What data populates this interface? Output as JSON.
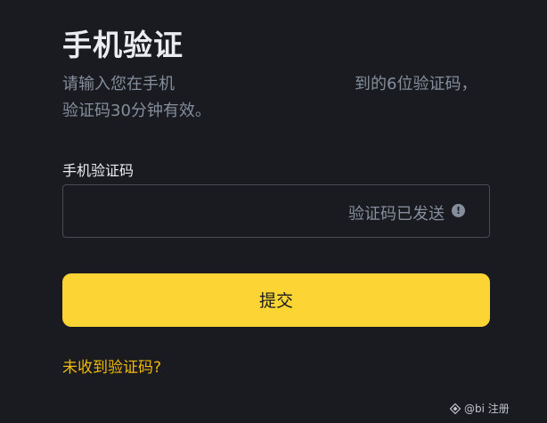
{
  "page": {
    "title": "手机验证",
    "description_line1_pre": "请输入您在手机",
    "description_line1_post": "到的6位验证码，",
    "description_line2": "验证码30分钟有效。"
  },
  "code_field": {
    "label": "手机验证码",
    "value": "",
    "status_text": "验证码已发送",
    "status_icon": "info-icon"
  },
  "submit_button": {
    "label": "提交"
  },
  "resend_link": {
    "label": "未收到验证码?"
  },
  "watermark": {
    "text": "@bi 注册"
  },
  "colors": {
    "background": "#1a1b20",
    "accent": "#fcd535",
    "link": "#f0b90b",
    "muted_text": "#848e9c"
  }
}
